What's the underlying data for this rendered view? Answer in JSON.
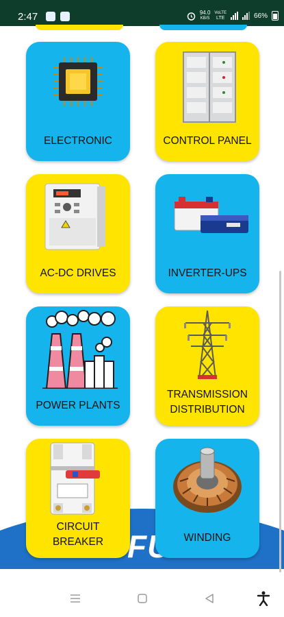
{
  "status_bar": {
    "time": "2:47",
    "network_speed_value": "94.0",
    "network_speed_unit": "KB/S",
    "network_type_top": "VoLTE",
    "network_type_bottom": "LTE",
    "battery": "66%"
  },
  "banner": {
    "text": "FUT"
  },
  "categories": [
    {
      "label": "ELECTRONIC",
      "color": "#16b4ec",
      "icon": "microchip-icon"
    },
    {
      "label": "CONTROL PANEL",
      "color": "#ffe400",
      "icon": "control-panel-cabinet-icon"
    },
    {
      "label": "AC-DC DRIVES",
      "color": "#ffe400",
      "icon": "ac-dc-drive-icon"
    },
    {
      "label": "INVERTER-UPS",
      "color": "#16b4ec",
      "icon": "inverter-battery-icon"
    },
    {
      "label": "POWER PLANTS",
      "color": "#16b4ec",
      "icon": "power-plant-icon"
    },
    {
      "label": "TRANSMISSION DISTRIBUTION",
      "line1": "TRANSMISSION",
      "line2": "DISTRIBUTION",
      "color": "#ffe400",
      "icon": "transmission-tower-icon"
    },
    {
      "label": "CIRCUIT BREAKER",
      "line1": "CIRCUIT",
      "line2": "BREAKER",
      "color": "#ffe400",
      "icon": "circuit-breaker-icon"
    },
    {
      "label": "WINDING",
      "color": "#16b4ec",
      "icon": "motor-winding-icon"
    }
  ],
  "nav_bar": {
    "icons": [
      "menu-icon",
      "home-icon",
      "back-icon",
      "accessibility-icon"
    ]
  }
}
